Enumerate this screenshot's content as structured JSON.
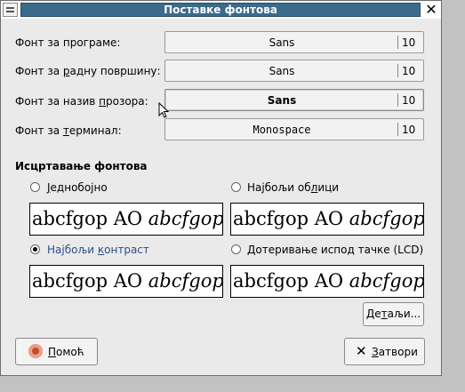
{
  "window": {
    "title": "Поставке фонтова",
    "close_glyph": "✕"
  },
  "fonts": [
    {
      "label": "Фонт за програме:",
      "font": "Sans",
      "size": "10"
    },
    {
      "label_pre": "Фонт за ",
      "label_u": "р",
      "label_post": "адну површину:",
      "font": "Sans",
      "size": "10"
    },
    {
      "label_pre": "Фонт за назив ",
      "label_u": "п",
      "label_post": "розора:",
      "font": "Sans",
      "size": "10"
    },
    {
      "label_pre": "Фонт за ",
      "label_u": "т",
      "label_post": "ерминал:",
      "font": "Monospace",
      "size": "10"
    }
  ],
  "rendering": {
    "heading": "Исцртавање фонтова",
    "options": [
      {
        "label_u": "Ј",
        "label_post": "еднобојно",
        "selected": false
      },
      {
        "label_pre": "Најбољи об",
        "label_u": "л",
        "label_post": "ици",
        "selected": false
      },
      {
        "label_pre": "Најбољи ",
        "label_u": "к",
        "label_post": "онтраст",
        "selected": true
      },
      {
        "label": "Дотеривање испод тачке (LCD)",
        "selected": false
      }
    ],
    "sample_roman": "abcfgop AO ",
    "sample_italic": "abcfgop"
  },
  "buttons": {
    "details_pre": "Де",
    "details_u": "т",
    "details_post": "аљи...",
    "help_pre": "",
    "help_u": "П",
    "help_post": "омоћ",
    "close_u": "З",
    "close_post": "атвори",
    "close_icon": "✕"
  },
  "colors": {
    "title_strip": "#3a6b8a",
    "selected_label": "#2c4f8a"
  }
}
